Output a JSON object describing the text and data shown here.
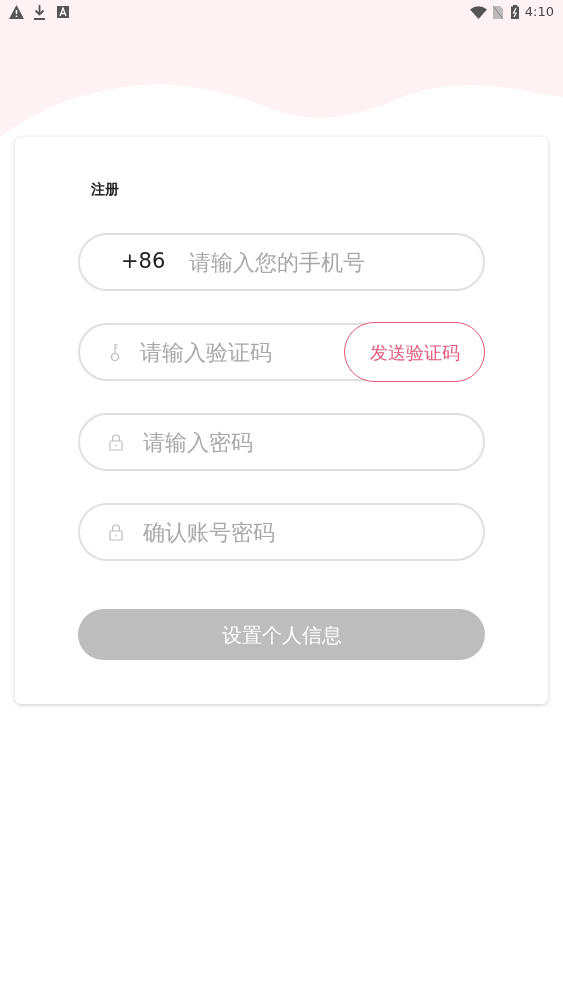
{
  "status_bar": {
    "time": "4:10"
  },
  "form": {
    "title": "注册",
    "fields": [
      {
        "kind": "phone",
        "prefix": "+86",
        "placeholder": "请输入您的手机号"
      },
      {
        "kind": "code",
        "placeholder": "请输入验证码",
        "action": "发送验证码"
      },
      {
        "kind": "password",
        "placeholder": "请输入密码"
      },
      {
        "kind": "password",
        "placeholder": "确认账号密码"
      }
    ],
    "submit": {
      "label": "设置个人信息",
      "disabled": true
    }
  }
}
